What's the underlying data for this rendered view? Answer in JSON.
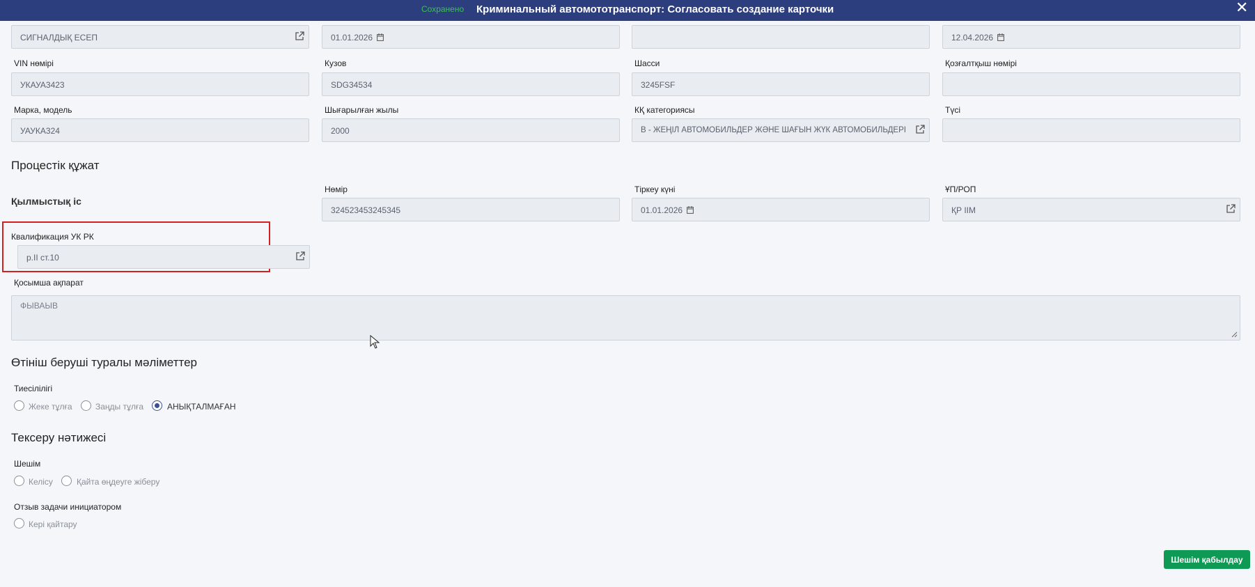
{
  "header": {
    "status": "Сохранено",
    "title": "Криминальный автомототранспорт: Согласовать создание карточки",
    "close": "✕"
  },
  "vehicle": {
    "row0": {
      "accounting_type": "СИГНАЛДЫҚ ЕСЕП",
      "date_start": "01.01.2026",
      "empty_value": "",
      "date_end": "12.04.2026"
    },
    "vin": {
      "label": "VIN нөмірі",
      "value": "УКАУА3423"
    },
    "body": {
      "label": "Кузов",
      "value": "SDG34534"
    },
    "chassis": {
      "label": "Шасси",
      "value": "3245FSF"
    },
    "engine": {
      "label": "Қозғалтқыш нөмірі",
      "value": ""
    },
    "brand": {
      "label": "Марка, модель",
      "value": "УАУКА324"
    },
    "year": {
      "label": "Шығарылған жылы",
      "value": "2000"
    },
    "category": {
      "label": "КҚ категориясы",
      "value": "B - ЖЕҢІЛ АВТОМОБИЛЬДЕР ЖӘНЕ ШАҒЫН ЖҮК АВТОМОБИЛЬДЕРІ"
    },
    "color": {
      "label": "Түсі",
      "value": ""
    }
  },
  "procedural": {
    "heading": "Процестік құжат",
    "case_label": "Қылмыстық іс",
    "number": {
      "label": "Нөмір",
      "value": "324523453245345"
    },
    "reg_date": {
      "label": "Тіркеу күні",
      "value": "01.01.2026"
    },
    "department": {
      "label": "ҰП/РОП",
      "value": "ҚР ІІМ"
    },
    "qualification": {
      "label": "Квалификация УК РК",
      "value": "p.II ст.10"
    },
    "additional": {
      "label": "Қосымша ақпарат",
      "value": "ФЫВАЫВ"
    }
  },
  "applicant": {
    "heading": "Өтініш беруші туралы мәліметтер",
    "belonging_label": "Тиесілілігі",
    "options": [
      "Жеке тұлға",
      "Заңды тұлға",
      "АНЫҚТАЛМАҒАН"
    ],
    "selected": "АНЫҚТАЛМАҒАН"
  },
  "review": {
    "heading": "Тексеру нәтижесі",
    "decision_label": "Шешім",
    "decision_options": [
      "Келісу",
      "Қайта өңдеуге жіберу"
    ],
    "feedback_label": "Отзыв задачи инициатором",
    "feedback_option": "Кері қайтару"
  },
  "actions": {
    "submit": "Шешім қабылдау"
  },
  "colors": {
    "header_bg": "#2d3e7f",
    "saved_text": "#3cbf55",
    "submit_bg": "#0e9a55",
    "highlight_border": "#d42020"
  },
  "icons": [
    "external-link-icon",
    "calendar-icon",
    "close-icon",
    "resize-handle-icon",
    "mouse-cursor-icon"
  ]
}
